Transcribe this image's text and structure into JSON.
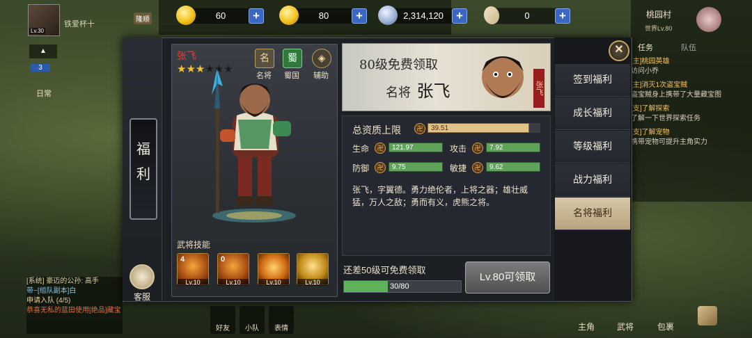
{
  "currency": [
    {
      "icon": "gold-coin-icon",
      "value": "60"
    },
    {
      "icon": "gold-ingot-icon",
      "value": "80"
    },
    {
      "icon": "silver-coin-icon",
      "value": "2,314,120"
    },
    {
      "icon": "scroll-icon",
      "value": "0"
    }
  ],
  "top_left": {
    "level": "Lv.30",
    "name": "铁爱杯十",
    "vip": "隆顺"
  },
  "left_tab": {
    "char1": "福",
    "char2": "利"
  },
  "service": {
    "label": "客服"
  },
  "hero": {
    "name": "张飞",
    "stars_filled": 3,
    "stars_total": 6,
    "badges": [
      {
        "glyph": "名",
        "label": "名将"
      },
      {
        "glyph": "蜀",
        "label": "蜀国"
      },
      {
        "glyph": "◈",
        "label": "辅助"
      }
    ],
    "skills_title": "武将技能",
    "skills": [
      {
        "num": "4",
        "level": "Lv.10"
      },
      {
        "num": "0",
        "level": "Lv.10"
      },
      {
        "num": "",
        "level": "Lv.10"
      },
      {
        "num": "",
        "level": "Lv.10"
      }
    ]
  },
  "banner": {
    "line1": "80级免费领取",
    "line2_prefix": "名将",
    "line2_name": "张飞",
    "tag": "张飞"
  },
  "stats": {
    "total_label": "总资质上限",
    "total_value": "39.51",
    "total_fill": 0.9,
    "rows": [
      {
        "label": "生命",
        "value": "121.97",
        "fill": 1.0
      },
      {
        "label": "攻击",
        "value": "7.92",
        "fill": 1.0
      },
      {
        "label": "防御",
        "value": "9.75",
        "fill": 1.0
      },
      {
        "label": "敏捷",
        "value": "9.62",
        "fill": 1.0
      }
    ],
    "desc": "张飞，字翼德。勇力绝伦者，上将之器；雄壮威猛，万人之敌；勇而有义，虎熊之将。"
  },
  "progress": {
    "label": "还差50级可免费领取",
    "text": "30/80",
    "fraction": 0.375
  },
  "claim_button": {
    "label": "Lv.80可领取"
  },
  "menu": [
    {
      "label": "签到福利",
      "active": false,
      "dot": true
    },
    {
      "label": "成长福利",
      "active": false,
      "dot": false
    },
    {
      "label": "等级福利",
      "active": false,
      "dot": false
    },
    {
      "label": "战力福利",
      "active": false,
      "dot": false
    },
    {
      "label": "名将福利",
      "active": true,
      "dot": false
    }
  ],
  "right_side": {
    "title": "桃园村",
    "world": "世界Lv.80",
    "tab1": "任务",
    "tab2": "队伍",
    "quests": [
      {
        "tag": "[主]桃园英雄",
        "desc": "访问小乔"
      },
      {
        "tag": "[主]消灭1次盗宝贼",
        "desc": "盗宝贼身上携带了大量藏宝图"
      },
      {
        "tag": "[支]了解探索",
        "desc": "了解一下世界探索任务"
      },
      {
        "tag": "[支]了解宠物",
        "desc": "携带宠物可提升主角实力"
      }
    ]
  },
  "chat": [
    {
      "text": "[系统] 豪迈的公孙: 高手"
    },
    {
      "text": "带~[组队副本]白"
    },
    {
      "text": "申请入队 (4/5)"
    },
    {
      "text": "恭喜无私的蓝田使用[绝品]藏宝"
    }
  ],
  "bottom_left": [
    {
      "label": "好友"
    },
    {
      "label": "小队"
    },
    {
      "label": "表情"
    }
  ],
  "bottom_right": [
    {
      "label": "主角"
    },
    {
      "label": "武将"
    },
    {
      "label": "包裹"
    }
  ],
  "left_side": {
    "num": "3",
    "label": "日常"
  },
  "colors": {
    "accent_green": "#5fa35a",
    "accent_gold": "#d8a04a",
    "hero_name_red": "#e8423a",
    "active_tab": "#c8b58f"
  }
}
